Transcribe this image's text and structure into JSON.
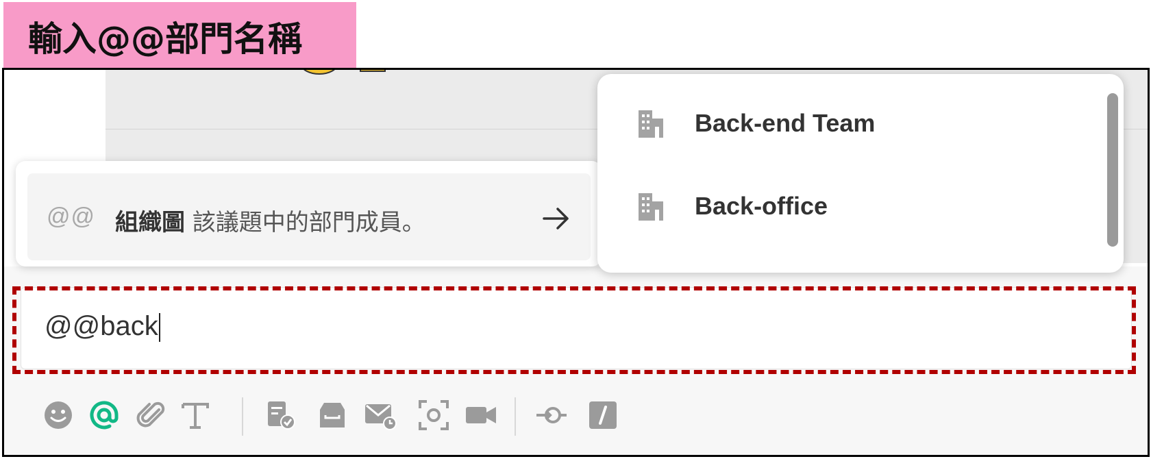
{
  "banner": {
    "text": "輸入@@部門名稱"
  },
  "hint": {
    "prefix": "@@",
    "text_bold": "組織圖",
    "text_rest": " 該議題中的部門成員。"
  },
  "mention_popup": {
    "items": [
      {
        "label": "Back-end Team",
        "icon": "building-icon"
      },
      {
        "label": "Back-office",
        "icon": "building-icon"
      }
    ]
  },
  "input": {
    "value": "@@back"
  },
  "toolbar": {
    "icons": [
      "emoji-icon",
      "mention-icon",
      "attachment-icon",
      "text-format-icon",
      "task-icon",
      "archive-icon",
      "mail-icon",
      "screenshot-icon",
      "video-icon",
      "integration-icon",
      "slash-command-icon"
    ],
    "accent": "#12b886"
  },
  "colors": {
    "highlight_border": "#b00000",
    "banner_bg": "#f89bc8"
  }
}
